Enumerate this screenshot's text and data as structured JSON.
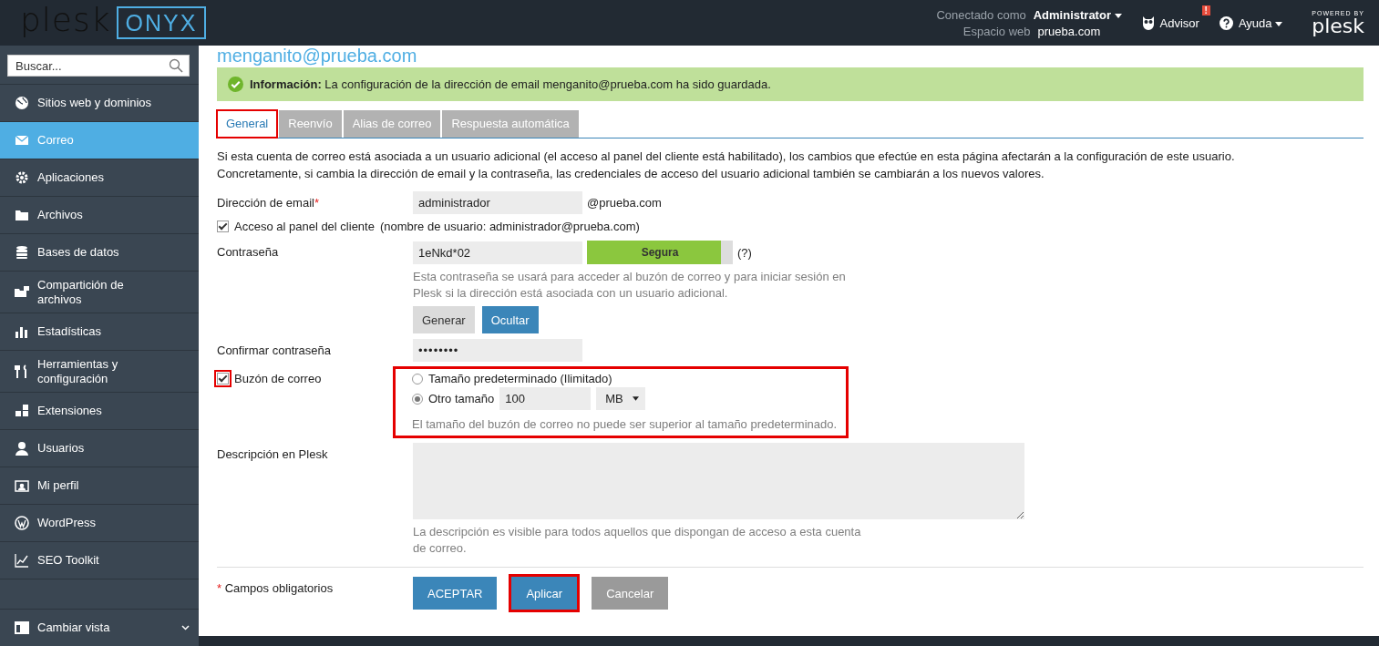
{
  "header": {
    "logo_text": "plesk",
    "edition": "ONYX",
    "connected_label": "Conectado como",
    "user": "Administrator",
    "webspace_label": "Espacio web",
    "webspace": "prueba.com",
    "advisor": "Advisor",
    "advisor_alert": "!",
    "help": "Ayuda",
    "powered_by": "POWERED BY",
    "powered_logo": "plesk"
  },
  "sidebar": {
    "search_placeholder": "Buscar...",
    "items": [
      {
        "label": "Sitios web y dominios",
        "selected": false
      },
      {
        "label": "Correo",
        "selected": true
      },
      {
        "label": "Aplicaciones",
        "selected": false
      },
      {
        "label": "Archivos",
        "selected": false
      },
      {
        "label": "Bases de datos",
        "selected": false
      },
      {
        "label": "Compartición de archivos",
        "selected": false
      },
      {
        "label": "Estadísticas",
        "selected": false
      },
      {
        "label": "Herramientas y configuración",
        "selected": false
      },
      {
        "label": "Extensiones",
        "selected": false
      },
      {
        "label": "Usuarios",
        "selected": false
      },
      {
        "label": "Mi perfil",
        "selected": false
      },
      {
        "label": "WordPress",
        "selected": false
      },
      {
        "label": "SEO Toolkit",
        "selected": false
      }
    ],
    "footer": "Cambiar vista"
  },
  "page": {
    "title": "menganito@prueba.com",
    "message": {
      "label": "Información:",
      "text": "La configuración de la dirección de email menganito@prueba.com ha sido guardada."
    },
    "tabs": [
      {
        "label": "General",
        "selected": true,
        "highlighted": true
      },
      {
        "label": "Reenvío",
        "selected": false,
        "highlighted": false
      },
      {
        "label": "Alias de correo",
        "selected": false,
        "highlighted": false
      },
      {
        "label": "Respuesta automática",
        "selected": false,
        "highlighted": false
      }
    ],
    "intro": "Si esta cuenta de correo está asociada a un usuario adicional (el acceso al panel del cliente está habilitado), los cambios que efectúe en esta página afectarán a la configuración de este usuario. Concretamente, si cambia la dirección de email y la contraseña, las credenciales de acceso del usuario adicional también se cambiarán a los nuevos valores.",
    "email": {
      "label": "Dirección de email",
      "required": true,
      "value": "administrador",
      "suffix": "@prueba.com"
    },
    "panel_access": {
      "label": "Acceso al panel del cliente",
      "note": "(nombre de usuario: administrador@prueba.com)",
      "checked": true
    },
    "password": {
      "label": "Contraseña",
      "value": "1eNkd*02",
      "strength": {
        "label": "Segura",
        "level": 0.92
      },
      "help": "(?)",
      "hint": "Esta contraseña se usará para acceder al buzón de correo y para iniciar sesión en Plesk si la dirección está asociada con un usuario adicional.",
      "buttons": [
        {
          "label": "Generar",
          "kind": "secondary"
        },
        {
          "label": "Ocultar",
          "kind": "primary"
        }
      ]
    },
    "confirm": {
      "label": "Confirmar contraseña",
      "value": "••••••••"
    },
    "mailbox": {
      "label": "Buzón de correo",
      "checked": true,
      "highlighted": true,
      "options_highlighted": true,
      "options": [
        {
          "label": "Tamaño predeterminado (Ilimitado)",
          "selected": false
        },
        {
          "label": "Otro tamaño",
          "selected": true
        }
      ],
      "size": "100",
      "unit": "MB",
      "hint": "El tamaño del buzón de correo no puede ser superior al tamaño predeterminado."
    },
    "description": {
      "label": "Descripción en Plesk",
      "hint": "La descripción es visible para todos aquellos que dispongan de acceso a esta cuenta de correo."
    },
    "required_note": {
      "mark": "*",
      "text": "Campos obligatorios"
    },
    "buttons": [
      {
        "label": "ACEPTAR",
        "kind": "primary",
        "highlighted": false
      },
      {
        "label": "Aplicar",
        "kind": "primary",
        "highlighted": true
      },
      {
        "label": "Cancelar",
        "kind": "secondary",
        "highlighted": false
      }
    ]
  }
}
